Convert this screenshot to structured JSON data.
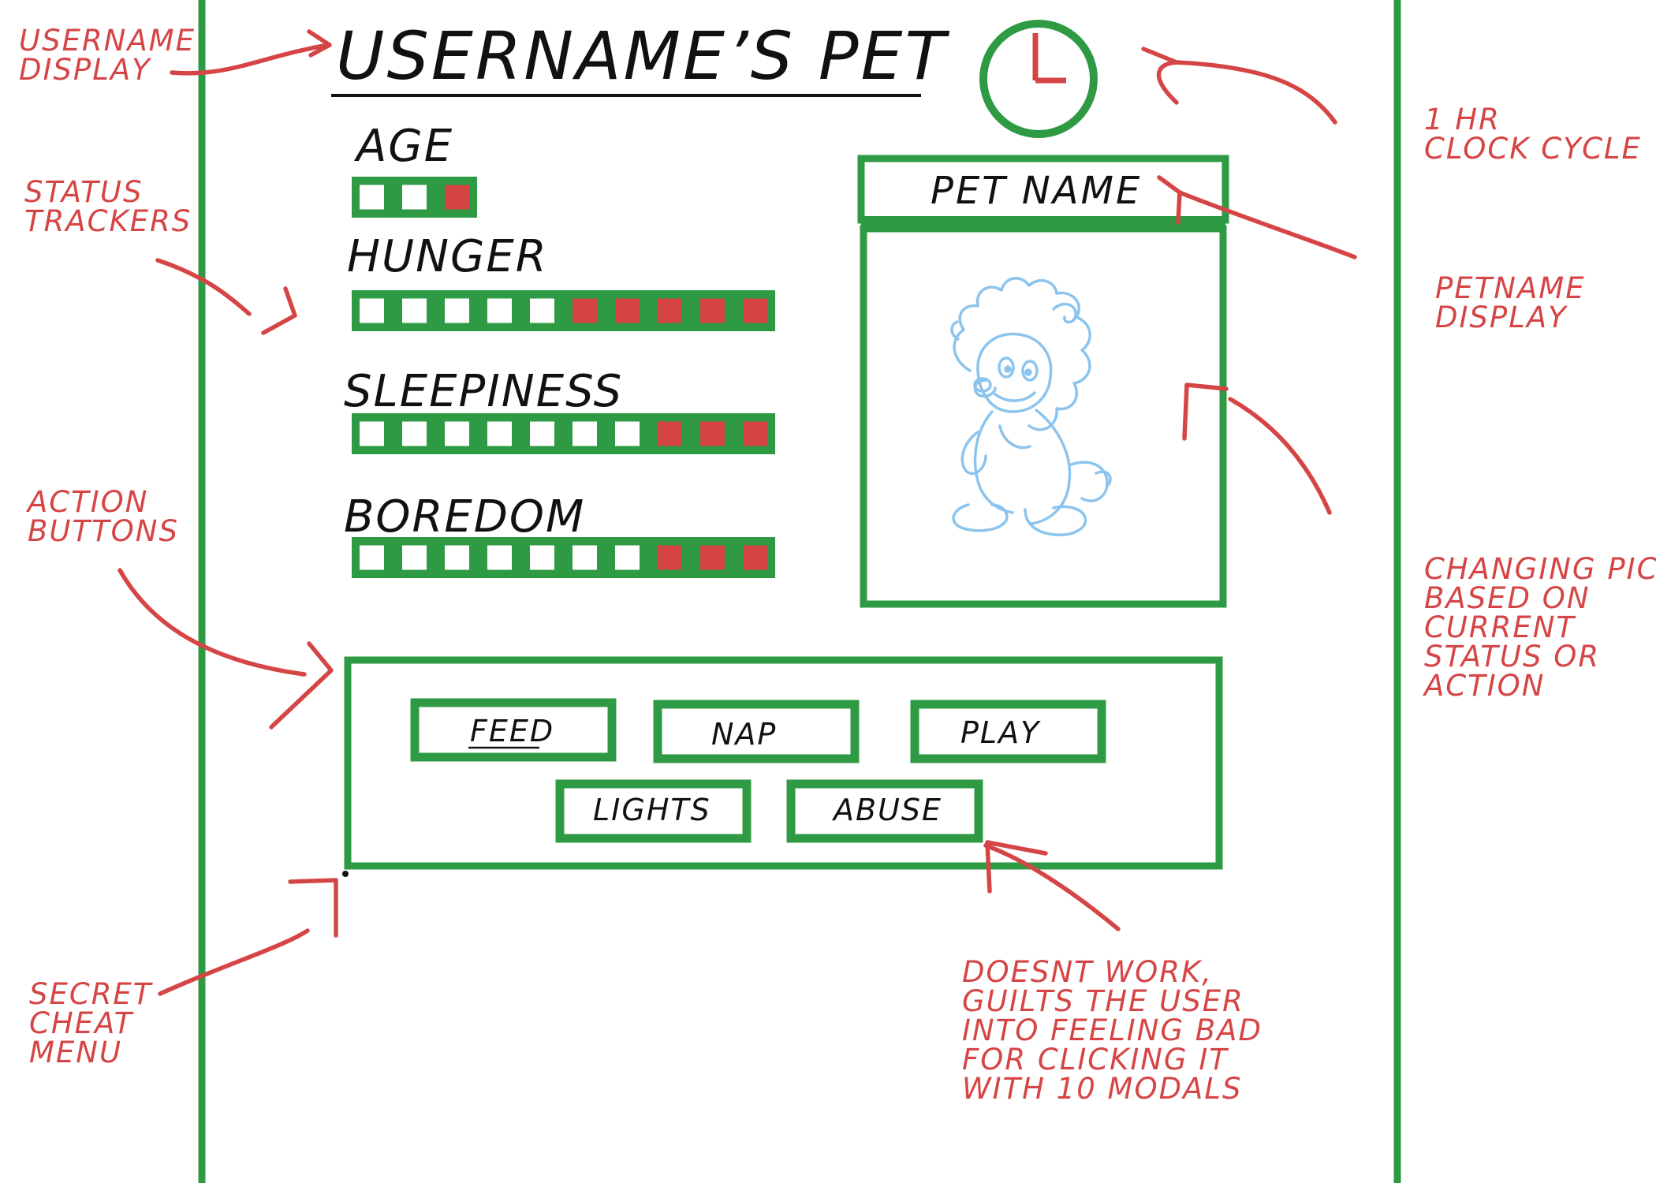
{
  "header": {
    "title": "USERNAME’S PET"
  },
  "stats": [
    {
      "label": "AGE",
      "filled": 1,
      "total": 3
    },
    {
      "label": "HUNGER",
      "filled": 5,
      "total": 10
    },
    {
      "label": "SLEEPINESS",
      "filled": 3,
      "total": 10
    },
    {
      "label": "BOREDOM",
      "filled": 3,
      "total": 10
    }
  ],
  "pet": {
    "name": "PET NAME",
    "picture": "lion-cub-sketch"
  },
  "buttons": {
    "feed": "FEED",
    "nap": "NAP",
    "play": "PLAY",
    "lights": "LIGHTS",
    "abuse": "ABUSE"
  },
  "annotations": {
    "username": [
      "USERNAME",
      "DISPLAY"
    ],
    "status": [
      "STATUS",
      "TRACKERS"
    ],
    "action": [
      "ACTION",
      "BUTTONS"
    ],
    "cheat": [
      "SECRET",
      "CHEAT",
      "MENU"
    ],
    "clock": [
      "1 HR",
      "CLOCK CYCLE"
    ],
    "petname": [
      "PETNAME",
      "DISPLAY"
    ],
    "pic": [
      "CHANGING PIC",
      "BASED ON",
      "CURRENT",
      "STATUS OR",
      "ACTION"
    ],
    "abuse": [
      "DOESNT WORK,",
      "GUILTS THE USER",
      "INTO FEELING BAD",
      "FOR CLICKING IT",
      "WITH 10 MODALS"
    ]
  },
  "colors": {
    "frame": "#2f9a44",
    "filled_cell": "#d64545",
    "empty_cell": "#ffffff",
    "annotation": "#d64545",
    "sketch": "#8cc4ee"
  }
}
